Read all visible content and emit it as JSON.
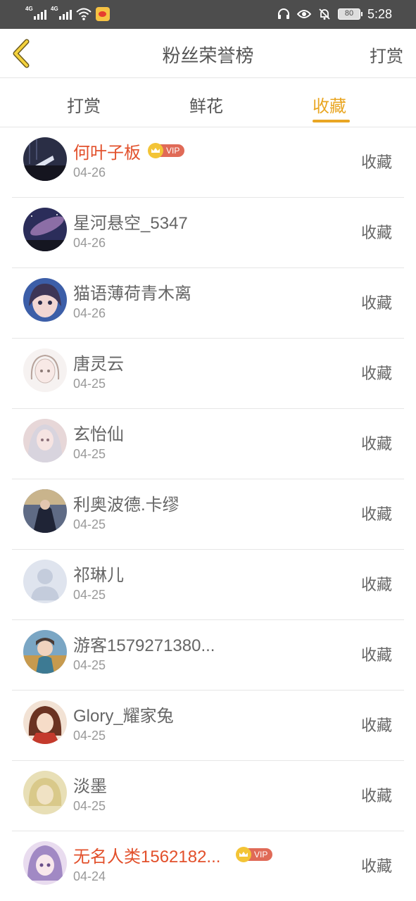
{
  "status_bar": {
    "network1": "4G",
    "network2": "4G",
    "battery": "80",
    "time": "5:28"
  },
  "header": {
    "title": "粉丝荣誉榜",
    "right_action": "打赏"
  },
  "tabs": [
    {
      "label": "打赏",
      "active": false
    },
    {
      "label": "鲜花",
      "active": false
    },
    {
      "label": "收藏",
      "active": true
    }
  ],
  "accent_color": "#e9a623",
  "vip_name_color": "#e2502b",
  "vip_label": "VIP",
  "fans": [
    {
      "name": "何叶子板",
      "date": "04-26",
      "action": "收藏",
      "vip": true
    },
    {
      "name": "星河悬空_5347",
      "date": "04-26",
      "action": "收藏",
      "vip": false
    },
    {
      "name": "猫语薄荷青木离",
      "date": "04-26",
      "action": "收藏",
      "vip": false
    },
    {
      "name": "唐灵云",
      "date": "04-25",
      "action": "收藏",
      "vip": false
    },
    {
      "name": "玄怡仙",
      "date": "04-25",
      "action": "收藏",
      "vip": false
    },
    {
      "name": "利奥波德.卡缪",
      "date": "04-25",
      "action": "收藏",
      "vip": false
    },
    {
      "name": "祁琳儿",
      "date": "04-25",
      "action": "收藏",
      "vip": false
    },
    {
      "name": "游客1579271380...",
      "date": "04-25",
      "action": "收藏",
      "vip": false
    },
    {
      "name": "Glory_耀家兔",
      "date": "04-25",
      "action": "收藏",
      "vip": false
    },
    {
      "name": "淡墨",
      "date": "04-25",
      "action": "收藏",
      "vip": false
    },
    {
      "name": "无名人类1562182...",
      "date": "04-24",
      "action": "收藏",
      "vip": true
    }
  ]
}
